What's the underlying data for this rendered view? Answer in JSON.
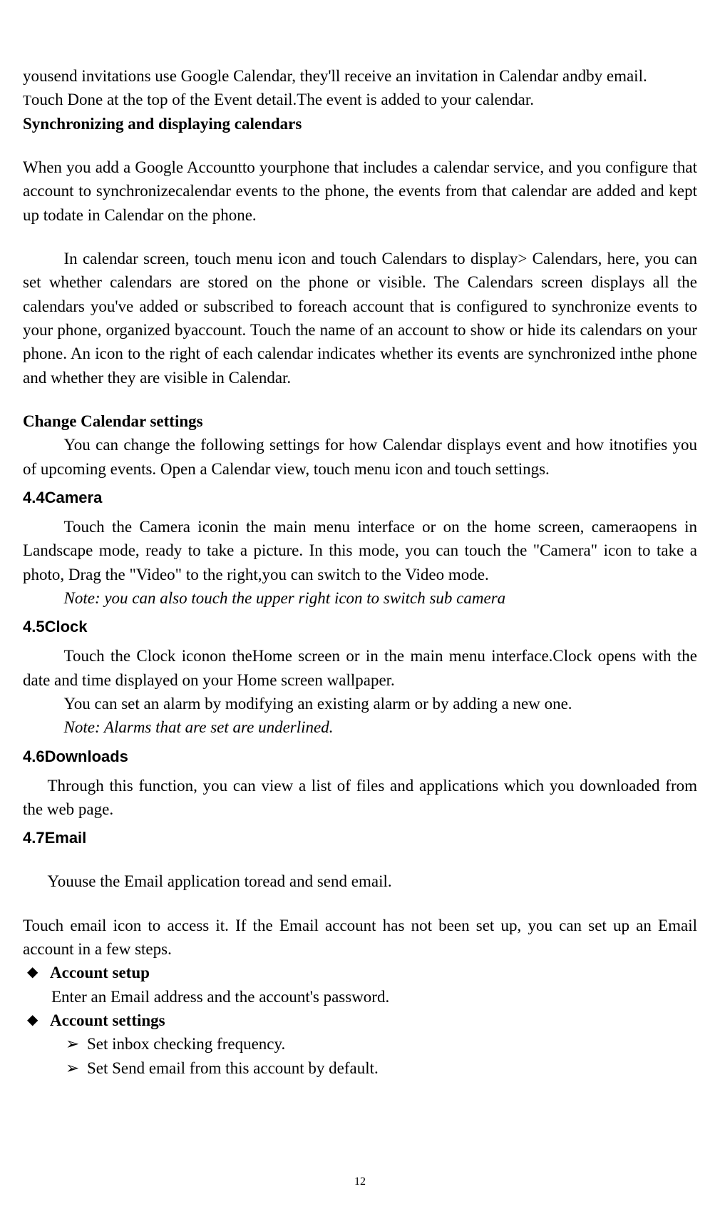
{
  "p1": "yousend invitations use Google Calendar, they'll receive an invitation in Calendar andby email.",
  "p2_prefix": "T",
  "p2": "ouch Done at the top of the Event detail.The event is added to your calendar.",
  "h_sync": "Synchronizing and displaying calendars",
  "p_sync_1": "When you add a Google Accountto yourphone that includes a calendar service, and you configure that account to synchronizecalendar events to the phone, the events from that calendar are added and kept up todate in Calendar on the phone.",
  "p_sync_2": "In calendar screen, touch menu icon and touch Calendars to display> Calendars, here, you can set whether calendars are stored on the phone or visible. The Calendars screen displays all the calendars you've added or subscribed to foreach account that is configured to synchronize events to your phone, organized byaccount. Touch the name of an account to show or hide its calendars on your phone. An icon to the right of each calendar indicates whether its events are synchronized inthe phone and whether they are visible in Calendar.",
  "h_change": "Change Calendar settings",
  "p_change": "You can change the following settings for how Calendar displays event and how itnotifies you of upcoming events. Open a Calendar view, touch menu icon and touch settings.",
  "h_camera": "4.4Camera",
  "p_camera": "Touch the Camera iconin the main menu interface or on the home screen, cameraopens in Landscape mode, ready to take a picture. In this mode, you can touch the \"Camera\" icon to take a photo, Drag the \"Video\" to the right,you can switch to the Video mode.",
  "p_camera_note": "Note: you can also touch the upper right icon to switch sub camera",
  "h_clock": "4.5Clock",
  "p_clock_1": "Touch the Clock iconon theHome screen or in the main menu interface.Clock opens with the date and time displayed on your Home screen wallpaper.",
  "p_clock_2": "You can set an alarm by modifying an existing alarm or by adding a new one.",
  "p_clock_note": "Note: Alarms that are set are underlined.",
  "h_downloads": "4.6Downloads",
  "p_downloads": "Through this function, you can view a list of files and applications which you downloaded from the web page.",
  "h_email": "4.7Email",
  "p_email_1": "Youuse the Email application toread and send email.",
  "p_email_2": "Touch email icon to access it. If the Email account has not been set up, you can set up an Email account in a few steps.",
  "bullet_sym": "◆",
  "arrow_sym": "➢",
  "b_account_setup": "Account setup",
  "p_account_setup": "Enter an Email address and the account's password.",
  "b_account_settings": "Account settings",
  "sub_1": "Set inbox checking frequency.",
  "sub_2": "Set Send email from this account by default.",
  "page_num": "12"
}
